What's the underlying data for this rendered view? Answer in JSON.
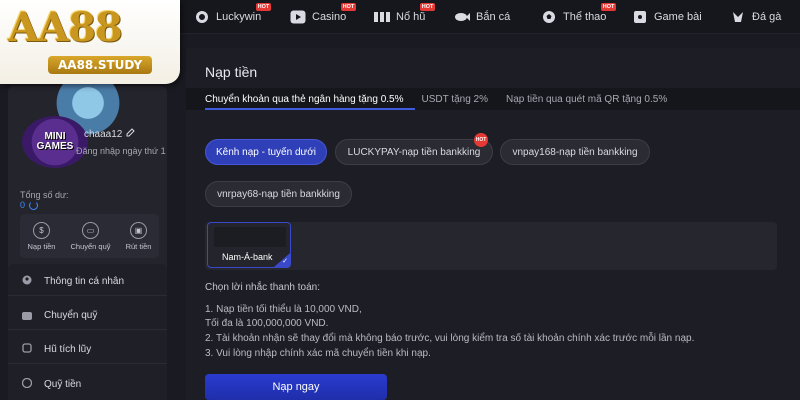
{
  "brand": {
    "logo_text": "AA88",
    "site": "AA88.STUDY",
    "colors": {
      "gold": "#c9961f",
      "accent": "#2f3fb8",
      "hot": "#e53935"
    }
  },
  "nav": [
    {
      "label": "Luckywin",
      "icon": "luckywin-icon",
      "hot": "HOT"
    },
    {
      "label": "Casino",
      "icon": "play-icon",
      "hot": "HOT"
    },
    {
      "label": "Nổ hũ",
      "icon": "slot-icon",
      "hot": "HOT"
    },
    {
      "label": "Bắn cá",
      "icon": "fish-icon",
      "hot": ""
    },
    {
      "label": "Thể thao",
      "icon": "soccer-icon",
      "hot": "HOT"
    },
    {
      "label": "Game bài",
      "icon": "cards-icon",
      "hot": ""
    },
    {
      "label": "Đá gà",
      "icon": "rooster-icon",
      "hot": ""
    }
  ],
  "profile": {
    "minigames_line1": "MINI",
    "minigames_line2": "GAMES",
    "username": "chaaa12",
    "login_days": "Đăng nhập ngày thứ 1"
  },
  "balance": {
    "label": "Tổng số dư:",
    "value": "0",
    "actions": [
      {
        "label": "Nạp tiền",
        "icon": "deposit-icon"
      },
      {
        "label": "Chuyển quỹ",
        "icon": "wallet-icon"
      },
      {
        "label": "Rút tiền",
        "icon": "withdraw-icon"
      }
    ]
  },
  "menu": [
    {
      "label": "Thông tin cá nhân",
      "icon": "user-icon"
    },
    {
      "label": "Chuyển quỹ",
      "icon": "wallet-icon"
    },
    {
      "label": "Hũ tích lũy",
      "icon": "jar-icon"
    },
    {
      "label": "Quỹ tiền",
      "icon": "fund-icon"
    }
  ],
  "page": {
    "title": "Nạp tiền",
    "promos": [
      "Chuyển khoản qua thẻ ngân hàng tặng 0.5%",
      "USDT tặng 2%",
      "Nạp tiền qua quét mã QR tặng 0.5%"
    ],
    "channels": [
      "Kênh nạp - tuyến dưới",
      "LUCKYPAY-nạp tiền bankking",
      "vnpay168-nạp tiền bankking",
      "vnrpay68-nạp tiền bankking"
    ],
    "channel_hot": "HOT",
    "bank": "Nam-Á-bank",
    "check": "✓",
    "notes_title": "Chọn lời nhắc thanh toán:",
    "notes": [
      "1. Nạp tiền tối thiểu là 10,000 VND,",
      "Tối đa là 100,000,000 VND.",
      "2. Tài khoản nhận sẽ thay đổi mà không báo trước, vui lòng kiểm tra số tài khoản chính xác trước mỗi lần nạp.",
      "3. Vui lòng nhập chính xác mã chuyển tiền khi nạp."
    ],
    "submit": "Nạp ngay"
  }
}
